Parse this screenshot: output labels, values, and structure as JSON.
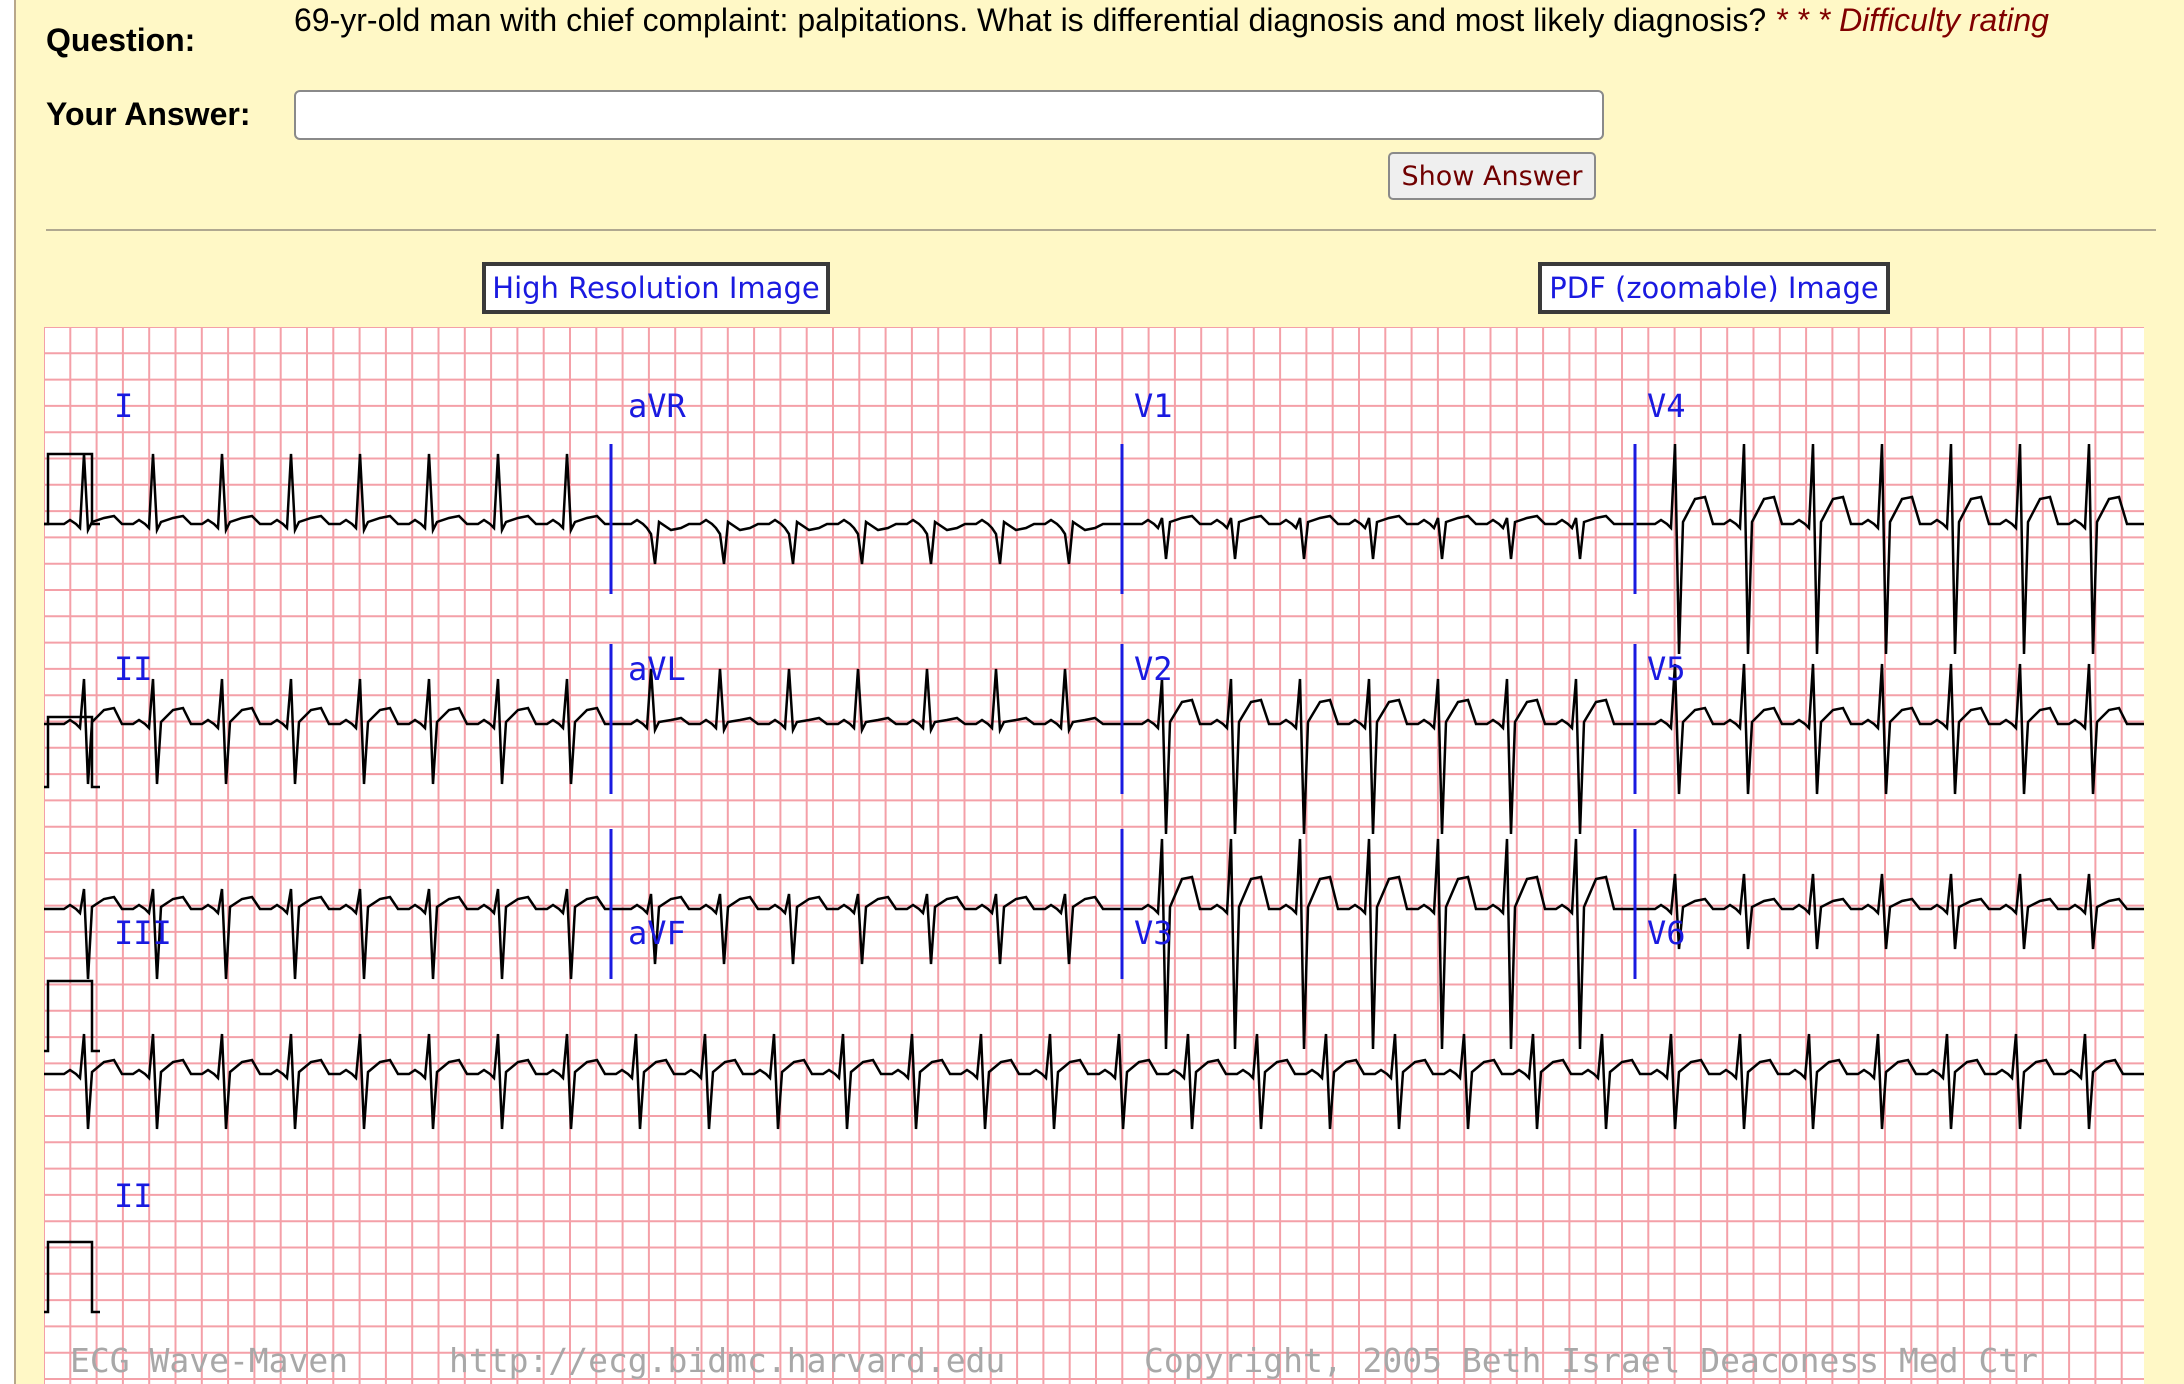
{
  "question": {
    "label": "Question:",
    "text": "69-yr-old man with chief complaint: palpitations. What is differential diagnosis and most likely diagnosis?",
    "difficulty": "* * *  Difficulty rating"
  },
  "answer": {
    "label": "Your Answer:",
    "value": "",
    "placeholder": ""
  },
  "show_answer_label": "Show Answer",
  "links": {
    "high_res": "High Resolution Image",
    "pdf": "PDF (zoomable) Image"
  },
  "ecg": {
    "leads": [
      "I",
      "aVR",
      "V1",
      "V4",
      "II",
      "aVL",
      "V2",
      "V5",
      "III",
      "aVF",
      "V3",
      "V6",
      "II"
    ],
    "footer": [
      "ECG Wave-Maven",
      "http://ecg.bidmc.harvard.edu",
      "Copyright, 2005 Beth Israel Deaconess Med Ctr"
    ]
  },
  "colors": {
    "background": "#fff8c6",
    "grid": "#f4a0a8",
    "trace": "#000000",
    "lead_label": "#1a1ae0",
    "difficulty": "#800000"
  }
}
